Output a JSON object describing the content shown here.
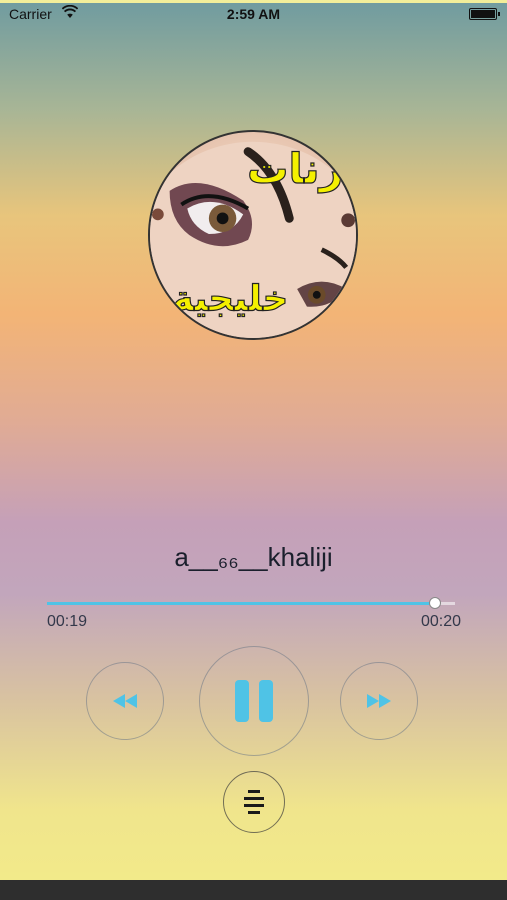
{
  "status_bar": {
    "carrier": "Carrier",
    "time": "2:59 AM",
    "wifi_icon": "wifi-icon",
    "battery_icon": "battery-full-icon"
  },
  "artwork": {
    "caption_top": "رنات",
    "caption_bottom": "خليجية",
    "caption_color": "#f4f000"
  },
  "track": {
    "title": "a__₆₆__khaliji"
  },
  "progress": {
    "elapsed": "00:19",
    "total": "00:20",
    "fraction": 0.95,
    "fill_color": "#4fc3e6"
  },
  "controls": {
    "previous_icon": "rewind-icon",
    "play_pause_icon": "pause-icon",
    "next_icon": "fast-forward-icon",
    "playlist_icon": "playlist-icon",
    "accent_color": "#4fc3e6"
  }
}
